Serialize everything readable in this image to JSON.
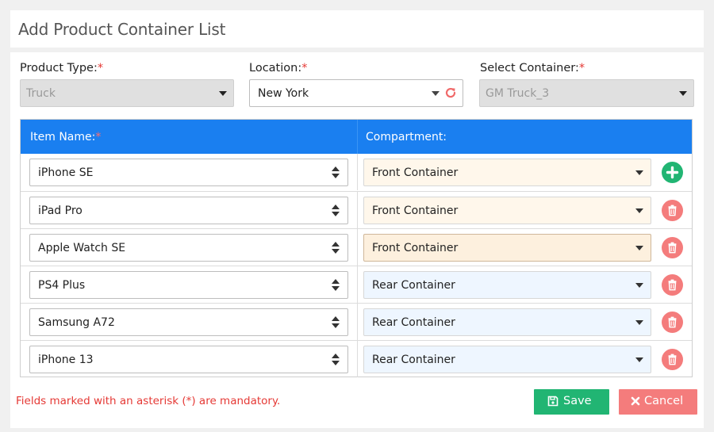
{
  "page": {
    "title": "Add Product Container List"
  },
  "form": {
    "product_type": {
      "label": "Product Type:",
      "required_mark": "*",
      "value": "Truck"
    },
    "location": {
      "label": "Location:",
      "required_mark": "*",
      "value": "New York"
    },
    "select_container": {
      "label": "Select Container:",
      "required_mark": "*",
      "value": "GM Truck_3"
    }
  },
  "grid": {
    "headers": {
      "item_name": "Item Name:",
      "item_required_mark": "*",
      "compartment": "Compartment:"
    },
    "rows": [
      {
        "item": "iPhone SE",
        "compartment": "Front Container",
        "action": "add"
      },
      {
        "item": "iPad Pro",
        "compartment": "Front Container",
        "action": "delete"
      },
      {
        "item": "Apple Watch SE",
        "compartment": "Front Container",
        "action": "delete"
      },
      {
        "item": "PS4 Plus",
        "compartment": "Rear Container",
        "action": "delete"
      },
      {
        "item": "Samsung A72",
        "compartment": "Rear Container",
        "action": "delete"
      },
      {
        "item": "iPhone 13",
        "compartment": "Rear Container",
        "action": "delete"
      }
    ]
  },
  "footer": {
    "note": "Fields marked with an asterisk (*) are mandatory.",
    "save_label": "Save",
    "cancel_label": "Cancel"
  },
  "colors": {
    "header_blue": "#1a7ff0",
    "save_green": "#21b573",
    "cancel_red": "#f47c7c",
    "required_red": "#e53935",
    "front_container_bg": "#fff7eb",
    "rear_container_bg": "#eef6ff"
  },
  "icons": {
    "add": "plus-circle-icon",
    "delete": "trash-icon",
    "refresh": "refresh-icon",
    "save": "save-icon",
    "cancel": "close-icon"
  }
}
